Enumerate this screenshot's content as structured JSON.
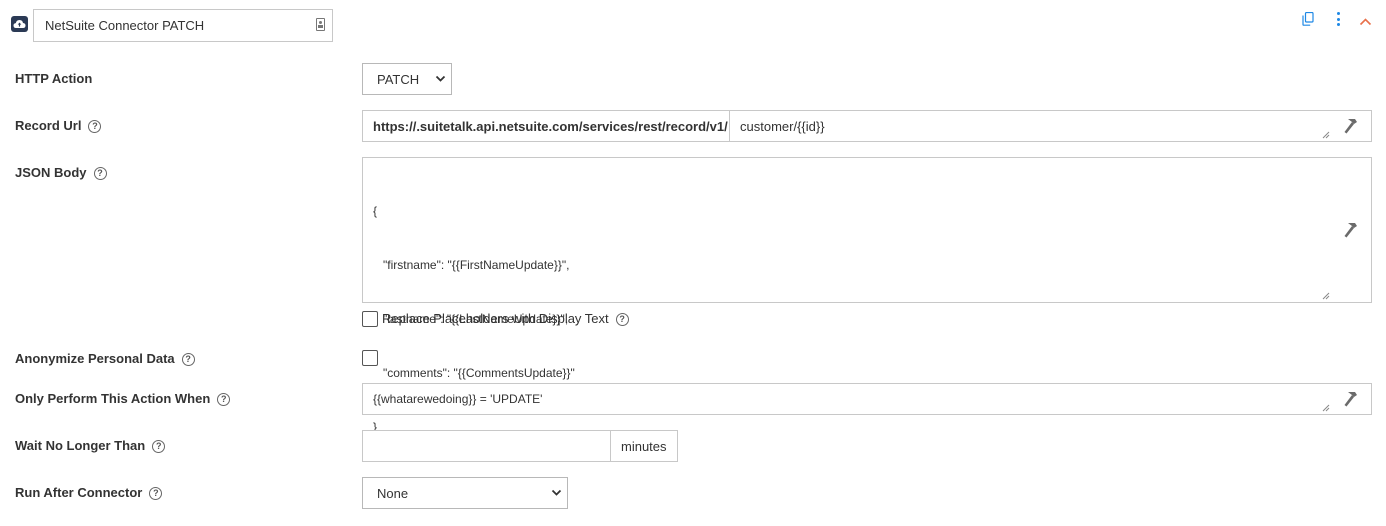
{
  "header": {
    "connector_icon": "cloud-upload-icon",
    "name_value": "NetSuite Connector PATCH",
    "copy_icon": "copy-icon",
    "more_icon": "more-vertical-icon",
    "collapse_icon": "chevron-up-icon",
    "accent_color": "#1e88e5",
    "collapse_color": "#e8704a"
  },
  "form": {
    "http_action": {
      "label": "HTTP Action",
      "value": "PATCH"
    },
    "record_url": {
      "label": "Record Url",
      "prefix": "https://.suitetalk.api.netsuite.com/services/rest/record/v1/",
      "value": "customer/{{id}}"
    },
    "json_body": {
      "label": "JSON Body",
      "lines": [
        "{",
        "   \"firstname\": \"{{FirstNameUpdate}}\",",
        "   \"lastname\": \"{{LastNameUpdate}}\",",
        "   \"comments\": \"{{CommentsUpdate}}\"",
        "}"
      ],
      "replace_placeholders_label": "Replace Placeholders with Display Text",
      "replace_placeholders_checked": false
    },
    "anonymize": {
      "label": "Anonymize Personal Data",
      "checked": false
    },
    "condition": {
      "label": "Only Perform This Action When",
      "value": "{{whatarewedoing}} = 'UPDATE'"
    },
    "wait": {
      "label": "Wait No Longer Than",
      "value": "",
      "unit": "minutes"
    },
    "run_after": {
      "label": "Run After Connector",
      "value": "None"
    }
  }
}
